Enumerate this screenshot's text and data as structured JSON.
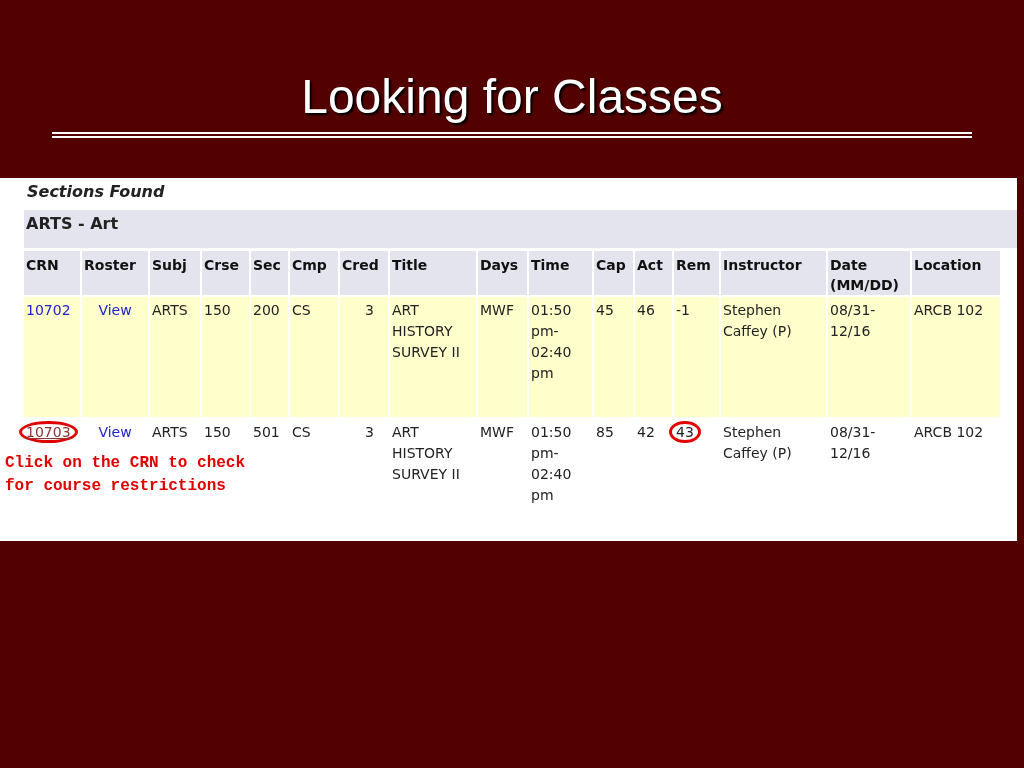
{
  "slide": {
    "title": "Looking for Classes"
  },
  "page": {
    "heading": "Sections Found",
    "subject": "ARTS - Art",
    "columns": [
      "CRN",
      "Roster",
      "Subj",
      "Crse",
      "Sec",
      "Cmp",
      "Cred",
      "Title",
      "Days",
      "Time",
      "Cap",
      "Act",
      "Rem",
      "Instructor",
      "Date (MM/DD)",
      "Location"
    ],
    "rows": [
      {
        "shaded": true,
        "crn_visited": false,
        "crn_circled": false,
        "rem_circled": false,
        "cells": [
          "10702",
          "View",
          "ARTS",
          "150",
          "200",
          "CS",
          "3",
          "ART HISTORY SURVEY II",
          "MWF",
          "01:50 pm-02:40 pm",
          "45",
          "46",
          "-1",
          "Stephen Caffey (P)",
          "08/31-12/16",
          "ARCB 102"
        ]
      },
      {
        "shaded": false,
        "crn_visited": true,
        "crn_circled": true,
        "rem_circled": true,
        "cells": [
          "10703",
          "View",
          "ARTS",
          "150",
          "501",
          "CS",
          "3",
          "ART HISTORY SURVEY II",
          "MWF",
          "01:50 pm-02:40 pm",
          "85",
          "42",
          "43",
          "Stephen Caffey (P)",
          "08/31-12/16",
          "ARCB 102"
        ]
      }
    ],
    "annotation": "Click on the CRN to check for course restrictions"
  }
}
